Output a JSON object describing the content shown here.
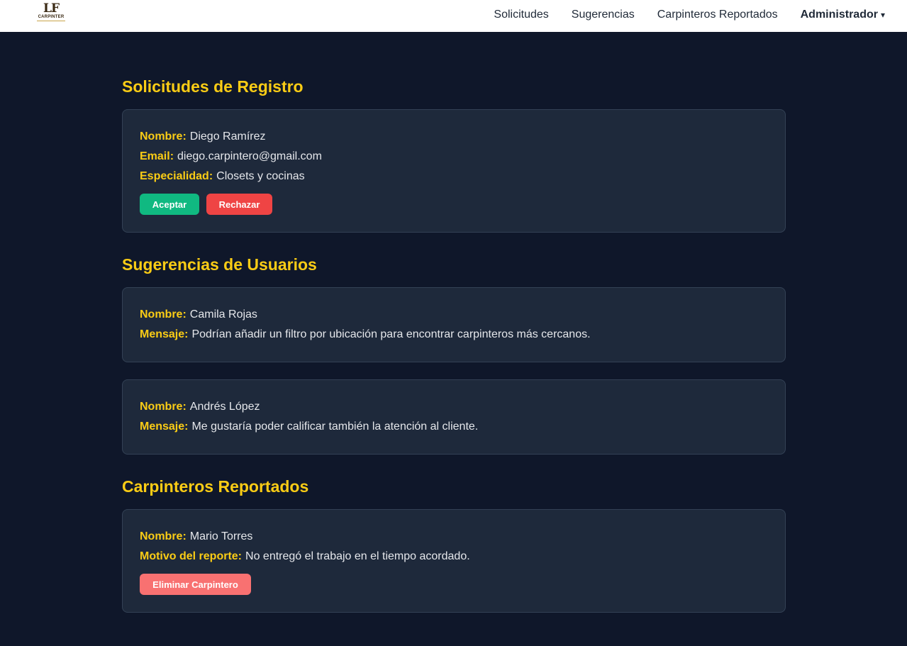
{
  "navbar": {
    "logo_mark": "LF",
    "logo_sub": "CARPINTER",
    "links": [
      "Solicitudes",
      "Sugerencias",
      "Carpinteros Reportados"
    ],
    "admin_label": "Administrador",
    "admin_caret": "▾"
  },
  "sections": {
    "requests": {
      "title": "Solicitudes de Registro",
      "item": {
        "name_label": "Nombre:",
        "name": "Diego Ramírez",
        "email_label": "Email:",
        "email": "diego.carpintero@gmail.com",
        "specialty_label": "Especialidad:",
        "specialty": "Closets y cocinas",
        "accept_label": "Aceptar",
        "reject_label": "Rechazar"
      }
    },
    "suggestions": {
      "title": "Sugerencias de Usuarios",
      "items": [
        {
          "name_label": "Nombre:",
          "name": "Camila Rojas",
          "message_label": "Mensaje:",
          "message": "Podrían añadir un filtro por ubicación para encontrar carpinteros más cercanos."
        },
        {
          "name_label": "Nombre:",
          "name": "Andrés López",
          "message_label": "Mensaje:",
          "message": "Me gustaría poder calificar también la atención al cliente."
        }
      ]
    },
    "reported": {
      "title": "Carpinteros Reportados",
      "item": {
        "name_label": "Nombre:",
        "name": "Mario Torres",
        "reason_label": "Motivo del reporte:",
        "reason": "No entregó el trabajo en el tiempo acordado.",
        "delete_label": "Eliminar Carpintero"
      }
    }
  },
  "colors": {
    "background": "#0f172a",
    "card": "#1e293b",
    "accent": "#facc15",
    "accept": "#10b981",
    "reject": "#ef4444",
    "delete": "#f87171"
  }
}
